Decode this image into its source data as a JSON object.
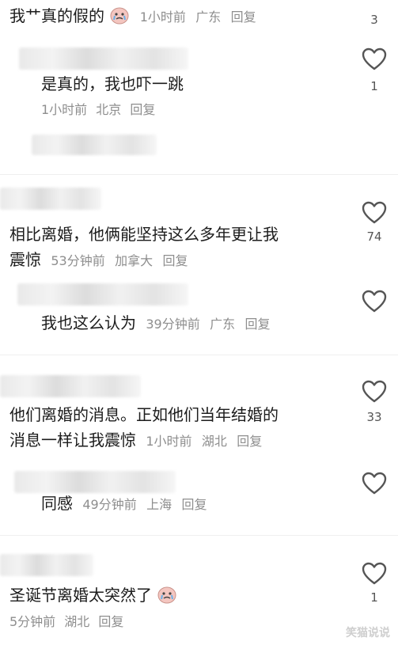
{
  "comments": [
    {
      "text": "我艹真的假的",
      "time": "1小时前",
      "location": "广东",
      "reply": "回复",
      "likes": "3",
      "emoji": "crying-face-icon"
    },
    {
      "text": "是真的，我也吓一跳",
      "time": "1小时前",
      "location": "北京",
      "reply": "回复",
      "likes": "1"
    },
    {
      "text_line1": "相比离婚，他俩能坚持这么多年更让我",
      "text_line2": "震惊",
      "time": "53分钟前",
      "location": "加拿大",
      "reply": "回复",
      "likes": "74"
    },
    {
      "text": "我也这么认为",
      "time": "39分钟前",
      "location": "广东",
      "reply": "回复",
      "likes": ""
    },
    {
      "text_line1": "他们离婚的消息。正如他们当年结婚的",
      "text_line2": "消息一样让我震惊",
      "time": "1小时前",
      "location": "湖北",
      "reply": "回复",
      "likes": "33"
    },
    {
      "text": "同感",
      "time": "49分钟前",
      "location": "上海",
      "reply": "回复",
      "likes": ""
    },
    {
      "text": "圣诞节离婚太突然了",
      "time": "5分钟前",
      "location": "湖北",
      "reply": "回复",
      "likes": "1",
      "emoji": "crying-face-icon"
    }
  ],
  "watermark": "笑猫说说"
}
